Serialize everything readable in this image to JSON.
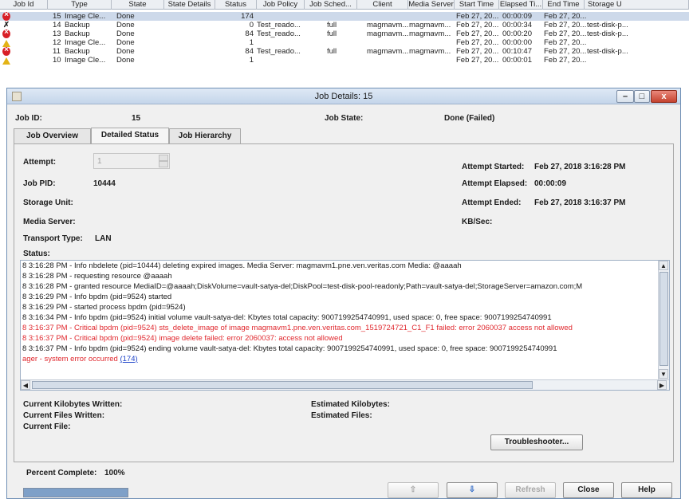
{
  "job_table": {
    "columns": [
      "Job Id",
      "Type",
      "State",
      "State Details",
      "Status",
      "Job Policy",
      "Job Sched...",
      "Client",
      "Media Server",
      "Start Time",
      "Elapsed Ti...",
      "End Time",
      "Storage U"
    ],
    "rows": [
      {
        "icon": "error-icon",
        "id": "15",
        "type": "Image Cle...",
        "state": "Done",
        "status": "174",
        "policy": "",
        "sched": "",
        "client": "",
        "media": "",
        "start": "Feb 27, 20...",
        "elapsed": "00:00:09",
        "end": "Feb 27, 20...",
        "storage": ""
      },
      {
        "icon": "running-icon",
        "id": "14",
        "type": "Backup",
        "state": "Done",
        "status": "0",
        "policy": "Test_reado...",
        "sched": "full",
        "client": "magmavm...",
        "media": "magmavm...",
        "start": "Feb 27, 20...",
        "elapsed": "00:00:34",
        "end": "Feb 27, 20...",
        "storage": "test-disk-p..."
      },
      {
        "icon": "error-icon",
        "id": "13",
        "type": "Backup",
        "state": "Done",
        "status": "84",
        "policy": "Test_reado...",
        "sched": "full",
        "client": "magmavm...",
        "media": "magmavm...",
        "start": "Feb 27, 20...",
        "elapsed": "00:00:20",
        "end": "Feb 27, 20...",
        "storage": "test-disk-p..."
      },
      {
        "icon": "warning-icon",
        "id": "12",
        "type": "Image Cle...",
        "state": "Done",
        "status": "1",
        "policy": "",
        "sched": "",
        "client": "",
        "media": "",
        "start": "Feb 27, 20...",
        "elapsed": "00:00:00",
        "end": "Feb 27, 20...",
        "storage": ""
      },
      {
        "icon": "error-icon",
        "id": "11",
        "type": "Backup",
        "state": "Done",
        "status": "84",
        "policy": "Test_reado...",
        "sched": "full",
        "client": "magmavm...",
        "media": "magmavm...",
        "start": "Feb 27, 20...",
        "elapsed": "00:10:47",
        "end": "Feb 27, 20...",
        "storage": "test-disk-p..."
      },
      {
        "icon": "warning-icon",
        "id": "10",
        "type": "Image Cle...",
        "state": "Done",
        "status": "1",
        "policy": "",
        "sched": "",
        "client": "",
        "media": "",
        "start": "Feb 27, 20...",
        "elapsed": "00:00:01",
        "end": "Feb 27, 20...",
        "storage": ""
      }
    ]
  },
  "dialog": {
    "title": "Job Details: 15",
    "minimize": "–",
    "maximize": "□",
    "close": "x",
    "job_id_label": "Job ID:",
    "job_id": "15",
    "job_state_label": "Job State:",
    "job_state": "Done (Failed)",
    "tabs": [
      "Job Overview",
      "Detailed Status",
      "Job Hierarchy"
    ],
    "attempt_label": "Attempt:",
    "attempt_value": "1",
    "job_pid_label": "Job PID:",
    "job_pid": "10444",
    "storage_unit_label": "Storage Unit:",
    "media_server_label": "Media Server:",
    "transport_type_label": "Transport Type:",
    "transport_type": "LAN",
    "attempt_started_label": "Attempt Started:",
    "attempt_started": "Feb 27, 2018 3:16:28 PM",
    "attempt_elapsed_label": "Attempt Elapsed:",
    "attempt_elapsed": "00:00:09",
    "attempt_ended_label": "Attempt Ended:",
    "attempt_ended": "Feb 27, 2018 3:16:37 PM",
    "kb_sec_label": "KB/Sec:",
    "status_label": "Status:",
    "log": [
      {
        "text": "8 3:16:28 PM - Info nbdelete (pid=10444) deleting expired images. Media Server: magmavm1.pne.ven.veritas.com Media: @aaaah",
        "level": "info"
      },
      {
        "text": "8 3:16:28 PM - requesting resource  @aaaah",
        "level": "info"
      },
      {
        "text": "8 3:16:28 PM - granted resource  MediaID=@aaaah;DiskVolume=vault-satya-del;DiskPool=test-disk-pool-readonly;Path=vault-satya-del;StorageServer=amazon.com;M",
        "level": "info"
      },
      {
        "text": "8 3:16:29 PM - Info bpdm (pid=9524) started",
        "level": "info"
      },
      {
        "text": "8 3:16:29 PM - started process bpdm (pid=9524)",
        "level": "info"
      },
      {
        "text": "8 3:16:34 PM - Info bpdm (pid=9524) initial volume vault-satya-del: Kbytes total capacity: 9007199254740991, used space: 0, free space: 9007199254740991",
        "level": "info"
      },
      {
        "text": "8 3:16:37 PM - Critical bpdm (pid=9524) sts_delete_image of image magmavm1.pne.ven.veritas.com_1519724721_C1_F1 failed: error 2060037 access not allowed",
        "level": "critical"
      },
      {
        "text": "8 3:16:37 PM - Critical bpdm (pid=9524) image delete failed: error 2060037: access not allowed",
        "level": "critical"
      },
      {
        "text": "8 3:16:37 PM - Info bpdm (pid=9524) ending volume vault-satya-del: Kbytes total capacity: 9007199254740991, used space: 0, free space: 9007199254740991",
        "level": "info"
      }
    ],
    "log_last_text": "ager - system error occurred",
    "log_last_link": "(174)",
    "current_kb_written_label": "Current Kilobytes Written:",
    "current_files_written_label": "Current Files Written:",
    "current_file_label": "Current File:",
    "estimated_kb_label": "Estimated Kilobytes:",
    "estimated_files_label": "Estimated Files:",
    "troubleshooter_label": "Troubleshooter...",
    "percent_complete_label": "Percent Complete:",
    "percent_complete": "100%",
    "progress_fraction": 1.0,
    "prev_label": "⇧",
    "next_label": "⇩",
    "refresh_label": "Refresh",
    "close_label": "Close",
    "help_label": "Help"
  }
}
